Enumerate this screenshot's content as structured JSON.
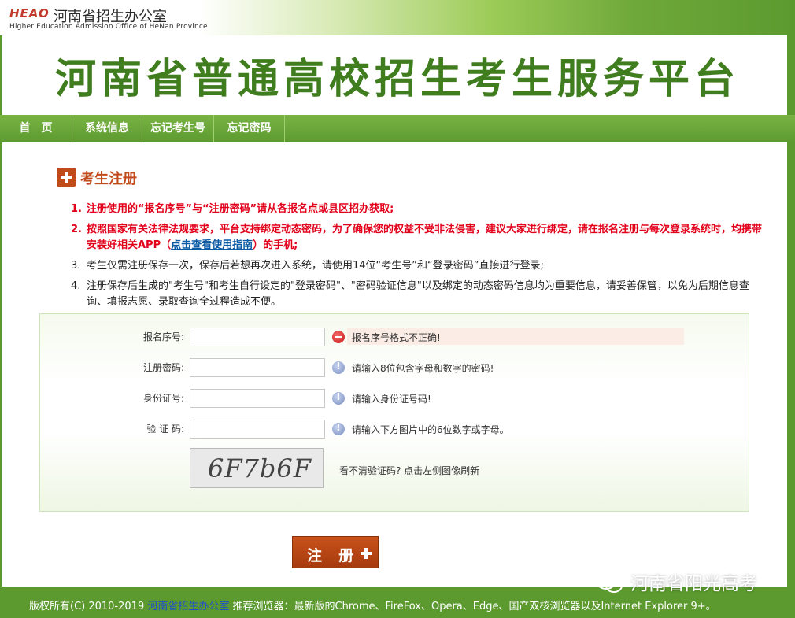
{
  "header": {
    "logo_text": "HEAO",
    "org_cn": "河南省招生办公室",
    "org_en": "Higher Education Admission Office of HeNan Province"
  },
  "banner": {
    "title": "河南省普通高校招生考生服务平台"
  },
  "nav": {
    "items": [
      {
        "label": "首　页"
      },
      {
        "label": "系统信息"
      },
      {
        "label": "忘记考生号"
      },
      {
        "label": "忘记密码"
      }
    ]
  },
  "section": {
    "title": "考生注册"
  },
  "notices": [
    {
      "num": "1.",
      "text": "注册使用的“报名序号”与“注册密码”请从各报名点或县区招办获取;"
    },
    {
      "num": "2.",
      "text_before": "按照国家有关法律法规要求，平台支持绑定动态密码，为了确保您的权益不受非法侵害，建议大家进行绑定，请在报名注册与每次登录系统时，均携带安装好相关APP（",
      "link": "点击查看使用指南",
      "text_after": "）的手机;"
    },
    {
      "num": "3.",
      "text": "考生仅需注册保存一次，保存后若想再次进入系统，请使用14位“考生号”和“登录密码”直接进行登录;"
    },
    {
      "num": "4.",
      "text": "注册保存后生成的\"考生号\"和考生自行设定的\"登录密码\"、\"密码验证信息\"以及绑定的动态密码信息均为重要信息，请妥善保管，以免为后期信息查询、填报志愿、录取查询全过程造成不便。"
    }
  ],
  "form": {
    "fields": [
      {
        "label": "报名序号:",
        "value": "",
        "status": "error",
        "message": "报名序号格式不正确!"
      },
      {
        "label": "注册密码:",
        "value": "",
        "status": "info",
        "message": "请输入8位包含字母和数字的密码!"
      },
      {
        "label": "身份证号:",
        "value": "",
        "status": "info",
        "message": "请输入身份证号码!"
      },
      {
        "label": "验 证 码:",
        "value": "",
        "status": "info",
        "message": "请输入下方图片中的6位数字或字母。"
      }
    ],
    "captcha_text": "6F7b6F",
    "captcha_hint": "看不清验证码? 点击左侧图像刷新"
  },
  "submit": {
    "label": "注 册"
  },
  "footer": {
    "copyright": "版权所有(C) 2010-2019",
    "org_link": "河南省招生办公室",
    "browser_note": "推荐浏览器：最新版的Chrome、FireFox、Opera、Edge、国产双核浏览器以及Internet Explorer 9+。"
  },
  "watermark": {
    "text": "河南省阳光高考"
  },
  "colors": {
    "brand_green": "#5c9a2f",
    "title_green": "#3f7d1f",
    "accent_orange": "#c04a1a",
    "warning_red": "#e3001b",
    "link_blue": "#0b5aa5"
  }
}
